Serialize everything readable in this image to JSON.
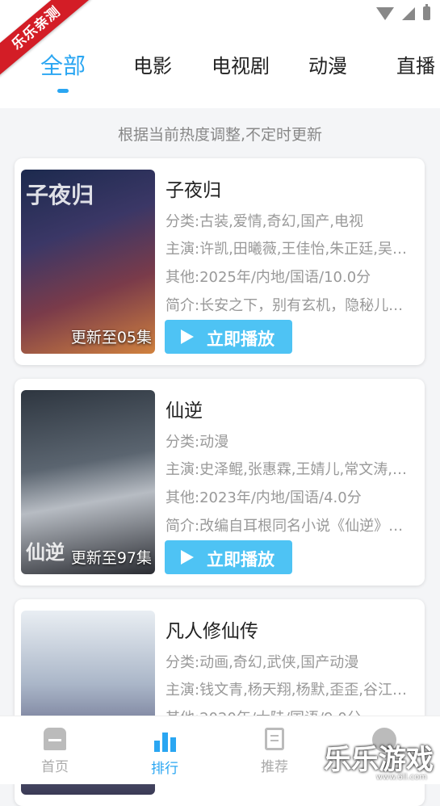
{
  "watermark_ribbon": "乐乐亲测",
  "tabs": [
    "全部",
    "电影",
    "电视剧",
    "动漫",
    "直播"
  ],
  "notice": "根据当前热度调整,不定时更新",
  "cards": [
    {
      "title": "子夜归",
      "category": "分类:古装,爱情,奇幻,国产,电视",
      "cast": "主演:许凯,田曦薇,王佳怡,朱正廷,吴…",
      "other": "其他:2025年/内地/国语/10.0分",
      "intro": "简介:长安之下，别有玄机，隐秘儿…",
      "update": "更新至05集",
      "play": "立即播放",
      "poster_logo": "子夜归"
    },
    {
      "title": "仙逆",
      "category": "分类:动漫",
      "cast": "主演:史泽鲲,张惠霖,王婧儿,常文涛,…",
      "other": "其他:2023年/内地/国语/4.0分",
      "intro": "简介:改编自耳根同名小说《仙逆》…",
      "update": "更新至97集",
      "play": "立即播放",
      "poster_logo": "仙逆"
    },
    {
      "title": "凡人修仙传",
      "category": "分类:动画,奇幻,武侠,国产动漫",
      "cast": "主演:钱文青,杨天翔,杨默,歪歪,谷江…",
      "other": "其他:2020年/大陆/国语/9.0分",
      "intro": "",
      "update": "",
      "play": "",
      "poster_logo": ""
    }
  ],
  "nav": [
    "首页",
    "排行",
    "推荐",
    ""
  ],
  "watermark_logo": "乐乐游戏",
  "watermark_url": "www.6ll.com",
  "colors": {
    "accent": "#2aa6f2",
    "play_button": "#4ec3f4",
    "ribbon": "#d31d26"
  }
}
